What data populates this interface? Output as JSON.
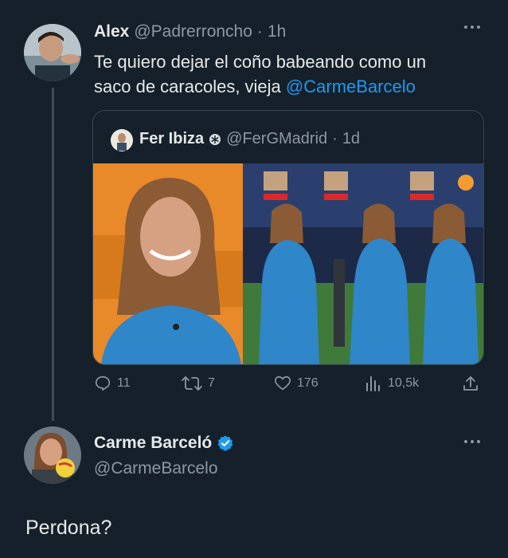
{
  "tweet": {
    "author_name": "Alex",
    "handle": "@Padrerroncho",
    "separator": "·",
    "time": "1h",
    "more_icon": "more-dots-icon",
    "text_line1": "Te quiero dejar el coño babeando como un",
    "text_line2_prefix": "saco de caracoles, vieja",
    "text_mention": "@CarmeBarcelo",
    "quote": {
      "author_name": "Fer Ibiza",
      "badge_icon": "snowflake-badge-icon",
      "handle": "@FerGMadrid",
      "separator": "·",
      "time": "1d"
    },
    "actions": {
      "replies": "11",
      "retweets": "7",
      "likes": "176",
      "views": "10,5k"
    }
  },
  "reply": {
    "author_name": "Carme Barceló",
    "verified_icon": "verified-badge-icon",
    "handle": "@CarmeBarcelo",
    "text": "Perdona?"
  },
  "colors": {
    "background": "#15202b",
    "text": "#e7e9ea",
    "muted": "#8b98a5",
    "accent": "#1d9bf0",
    "border": "#38444d"
  }
}
